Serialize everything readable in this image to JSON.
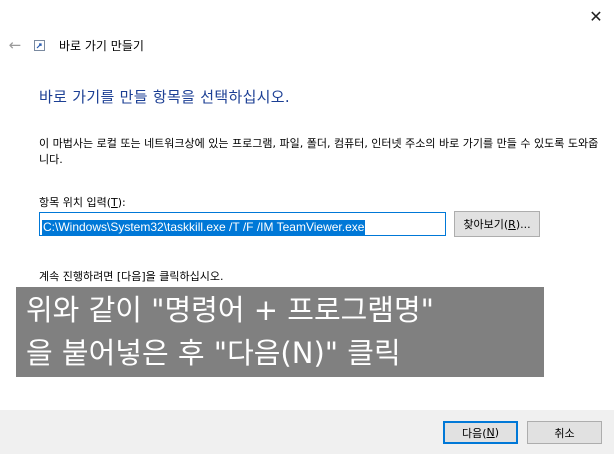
{
  "window": {
    "close_glyph": "✕"
  },
  "header": {
    "back_glyph": "←",
    "wizard_title": "바로 가기 만들기"
  },
  "main": {
    "heading": "바로 가기를 만들 항목을 선택하십시오.",
    "description": "이 마법사는 로컬 또는 네트워크상에 있는 프로그램, 파일, 폴더, 컴퓨터, 인터넷 주소의 바로 가기를 만들 수 있도록 도와줍니다.",
    "location_label_prefix": "항목 위치 입력(",
    "location_label_key": "T",
    "location_label_suffix": "):",
    "location_value": "C:\\Windows\\System32\\taskkill.exe /T /F /IM TeamViewer.exe",
    "browse_prefix": "찾아보기(",
    "browse_key": "R",
    "browse_suffix": ")...",
    "continue_text": "계속 진행하려면 [다음]을 클릭하십시오."
  },
  "overlay": {
    "line1": "위와 같이 \"명령어 + 프로그램명\"",
    "line2": "을 붙어넣은 후 \"다음(N)\" 클릭"
  },
  "footer": {
    "next_prefix": "다음(",
    "next_key": "N",
    "next_suffix": ")",
    "cancel_label": "취소"
  },
  "colors": {
    "heading": "#1c3f94",
    "selection": "#0078d7",
    "overlay_bg": "#808080",
    "footer_bg": "#f0f0f0"
  },
  "icons": {
    "close": "close-icon",
    "back": "back-arrow-icon",
    "wizard": "shortcut-wizard-icon"
  }
}
